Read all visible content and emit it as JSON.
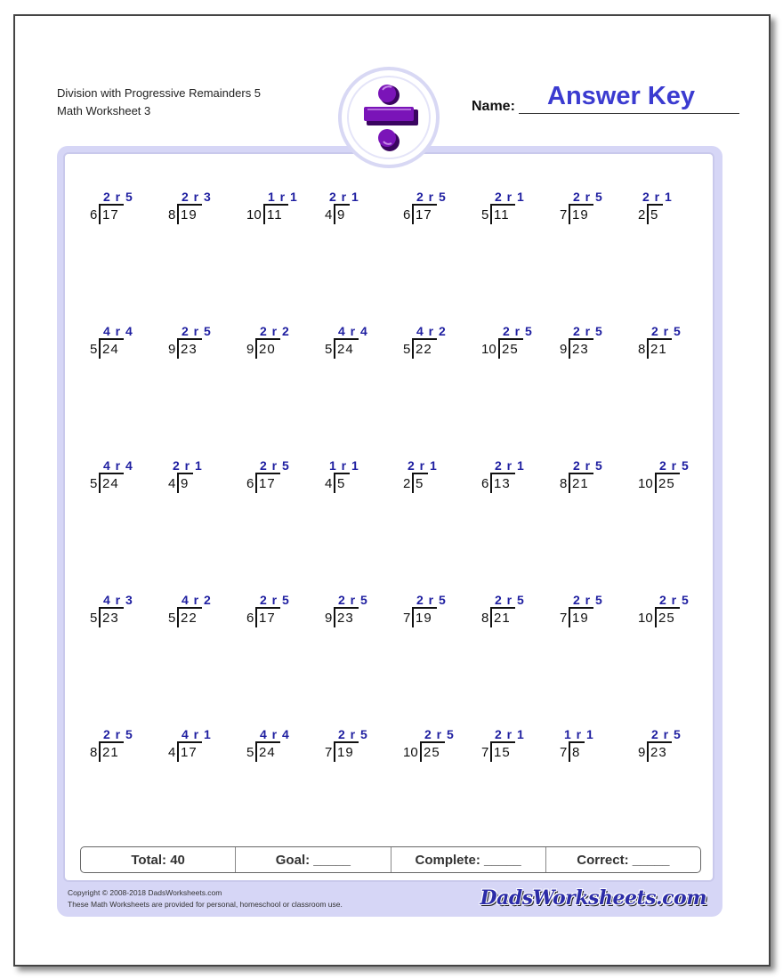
{
  "header": {
    "title": "Division with Progressive Remainders 5",
    "subtitle": "Math Worksheet 3",
    "logo_icon": "division-sign-icon",
    "name_label": "Name:",
    "name_value": "Answer Key"
  },
  "colors": {
    "answer": "#1e1ea0",
    "answer_key": "#3b3bd0",
    "frame": "#d6d6f6",
    "logo_purple": "#6a0dad"
  },
  "problems": [
    [
      {
        "divisor": "6",
        "dividend": "17",
        "answer": "2 r 5"
      },
      {
        "divisor": "8",
        "dividend": "19",
        "answer": "2 r 3"
      },
      {
        "divisor": "10",
        "dividend": "11",
        "answer": "1 r 1"
      },
      {
        "divisor": "4",
        "dividend": "9",
        "answer": "2 r 1"
      },
      {
        "divisor": "6",
        "dividend": "17",
        "answer": "2 r 5"
      },
      {
        "divisor": "5",
        "dividend": "11",
        "answer": "2 r 1"
      },
      {
        "divisor": "7",
        "dividend": "19",
        "answer": "2 r 5"
      },
      {
        "divisor": "2",
        "dividend": "5",
        "answer": "2 r 1"
      }
    ],
    [
      {
        "divisor": "5",
        "dividend": "24",
        "answer": "4 r 4"
      },
      {
        "divisor": "9",
        "dividend": "23",
        "answer": "2 r 5"
      },
      {
        "divisor": "9",
        "dividend": "20",
        "answer": "2 r 2"
      },
      {
        "divisor": "5",
        "dividend": "24",
        "answer": "4 r 4"
      },
      {
        "divisor": "5",
        "dividend": "22",
        "answer": "4 r 2"
      },
      {
        "divisor": "10",
        "dividend": "25",
        "answer": "2 r 5"
      },
      {
        "divisor": "9",
        "dividend": "23",
        "answer": "2 r 5"
      },
      {
        "divisor": "8",
        "dividend": "21",
        "answer": "2 r 5"
      }
    ],
    [
      {
        "divisor": "5",
        "dividend": "24",
        "answer": "4 r 4"
      },
      {
        "divisor": "4",
        "dividend": "9",
        "answer": "2 r 1"
      },
      {
        "divisor": "6",
        "dividend": "17",
        "answer": "2 r 5"
      },
      {
        "divisor": "4",
        "dividend": "5",
        "answer": "1 r 1"
      },
      {
        "divisor": "2",
        "dividend": "5",
        "answer": "2 r 1"
      },
      {
        "divisor": "6",
        "dividend": "13",
        "answer": "2 r 1"
      },
      {
        "divisor": "8",
        "dividend": "21",
        "answer": "2 r 5"
      },
      {
        "divisor": "10",
        "dividend": "25",
        "answer": "2 r 5"
      }
    ],
    [
      {
        "divisor": "5",
        "dividend": "23",
        "answer": "4 r 3"
      },
      {
        "divisor": "5",
        "dividend": "22",
        "answer": "4 r 2"
      },
      {
        "divisor": "6",
        "dividend": "17",
        "answer": "2 r 5"
      },
      {
        "divisor": "9",
        "dividend": "23",
        "answer": "2 r 5"
      },
      {
        "divisor": "7",
        "dividend": "19",
        "answer": "2 r 5"
      },
      {
        "divisor": "8",
        "dividend": "21",
        "answer": "2 r 5"
      },
      {
        "divisor": "7",
        "dividend": "19",
        "answer": "2 r 5"
      },
      {
        "divisor": "10",
        "dividend": "25",
        "answer": "2 r 5"
      }
    ],
    [
      {
        "divisor": "8",
        "dividend": "21",
        "answer": "2 r 5"
      },
      {
        "divisor": "4",
        "dividend": "17",
        "answer": "4 r 1"
      },
      {
        "divisor": "5",
        "dividend": "24",
        "answer": "4 r 4"
      },
      {
        "divisor": "7",
        "dividend": "19",
        "answer": "2 r 5"
      },
      {
        "divisor": "10",
        "dividend": "25",
        "answer": "2 r 5"
      },
      {
        "divisor": "7",
        "dividend": "15",
        "answer": "2 r 1"
      },
      {
        "divisor": "7",
        "dividend": "8",
        "answer": "1 r 1"
      },
      {
        "divisor": "9",
        "dividend": "23",
        "answer": "2 r 5"
      }
    ]
  ],
  "score": {
    "total": "Total: 40",
    "goal": "Goal: _____",
    "complete": "Complete: _____",
    "correct": "Correct: _____"
  },
  "footer": {
    "copyright": "Copyright © 2008-2018 DadsWorksheets.com",
    "usage": "These Math Worksheets are provided for personal, homeschool or classroom use.",
    "brand": "DadsWorksheets.com"
  }
}
